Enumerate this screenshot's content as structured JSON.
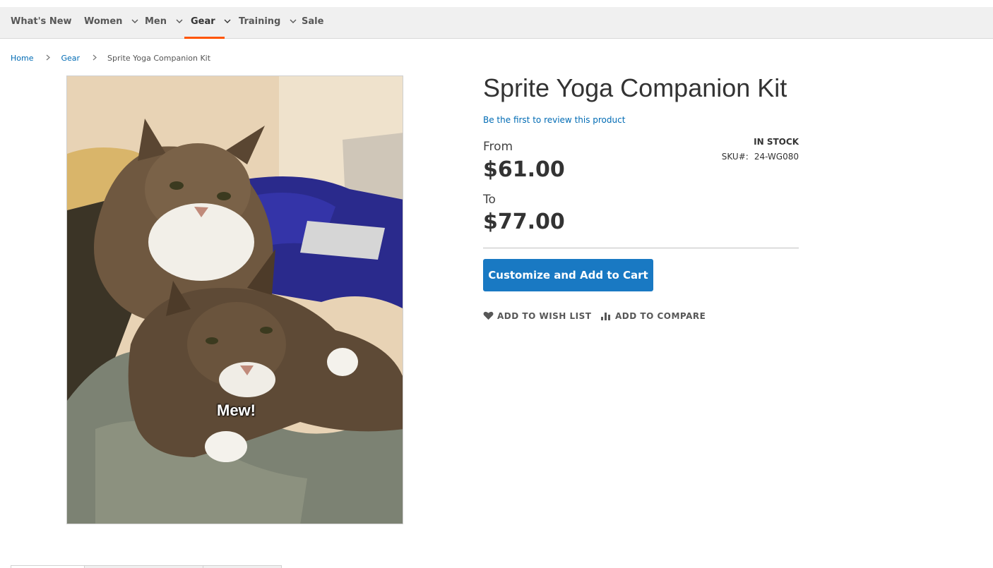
{
  "nav": {
    "items": [
      {
        "label": "What's New",
        "has_dropdown": false,
        "active": false
      },
      {
        "label": "Women",
        "has_dropdown": true,
        "active": false
      },
      {
        "label": "Men",
        "has_dropdown": true,
        "active": false
      },
      {
        "label": "Gear",
        "has_dropdown": true,
        "active": true
      },
      {
        "label": "Training",
        "has_dropdown": true,
        "active": false
      },
      {
        "label": "Sale",
        "has_dropdown": false,
        "active": false
      }
    ]
  },
  "breadcrumb": {
    "home": "Home",
    "category": "Gear",
    "current": "Sprite Yoga Companion Kit"
  },
  "product": {
    "title": "Sprite Yoga Companion Kit",
    "review_link": "Be the first to review this product",
    "price_from_label": "From",
    "price_from": "$61.00",
    "price_to_label": "To",
    "price_to": "$77.00",
    "stock_status": "IN STOCK",
    "sku_label": "SKU#:",
    "sku_value": "24-WG080",
    "image_caption": "Mew!"
  },
  "actions": {
    "cart_button": "Customize and Add to Cart",
    "wishlist": "ADD TO WISH LIST",
    "compare": "ADD TO COMPARE"
  },
  "colors": {
    "accent": "#1979c3",
    "link": "#006bb4",
    "active_underline": "#ff5501"
  }
}
